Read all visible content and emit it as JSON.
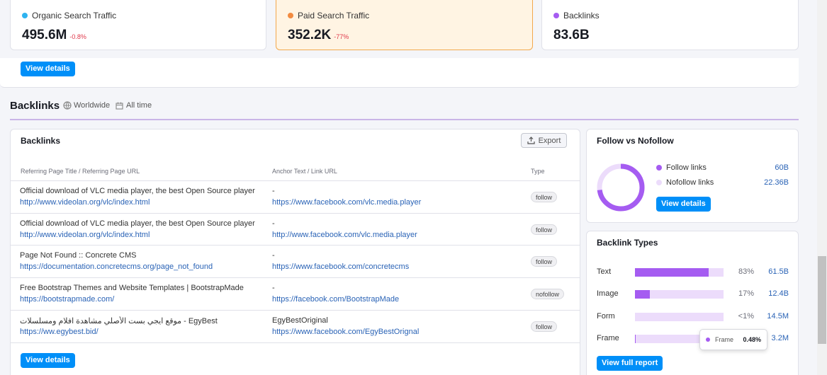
{
  "kpis": [
    {
      "label": "Organic Search Traffic",
      "value": "495.6M",
      "delta": "-0.8%",
      "color": "#2eb3f0"
    },
    {
      "label": "Paid Search Traffic",
      "value": "352.2K",
      "delta": "-77%",
      "color": "#f28b40"
    },
    {
      "label": "Backlinks",
      "value": "83.6B",
      "delta": "",
      "color": "#a55cf1"
    }
  ],
  "overview": {
    "view_details": "View details"
  },
  "section": {
    "title": "Backlinks",
    "region": "Worldwide",
    "period": "All time"
  },
  "backlinks_table": {
    "title": "Backlinks",
    "export_label": "Export",
    "columns": [
      "Referring Page Title / Referring Page URL",
      "Anchor Text / Link URL",
      "Type"
    ],
    "rows": [
      {
        "title": "Official download of VLC media player, the best Open Source player",
        "url": "http://www.videolan.org/vlc/index.html",
        "anchor": "-",
        "link": "https://www.facebook.com/vlc.media.player",
        "type": "follow"
      },
      {
        "title": "Official download of VLC media player, the best Open Source player",
        "url": "http://www.videolan.org/vlc/index.html",
        "anchor": "-",
        "link": "http://www.facebook.com/vlc.media.player",
        "type": "follow"
      },
      {
        "title": "Page Not Found :: Concrete CMS",
        "url": "https://documentation.concretecms.org/page_not_found",
        "anchor": "-",
        "link": "https://www.facebook.com/concretecms",
        "type": "follow"
      },
      {
        "title": "Free Bootstrap Themes and Website Templates | BootstrapMade",
        "url": "https://bootstrapmade.com/",
        "anchor": "-",
        "link": "https://facebook.com/BootstrapMade",
        "type": "nofollow"
      },
      {
        "title": "موقع ايجي بست الأصلي مشاهدة افلام ومسلسلات - EgyBest",
        "url": "https://ww.egybest.bid/",
        "anchor": "EgyBestOriginal",
        "link": "https://www.facebook.com/EgyBestOrignal",
        "type": "follow"
      }
    ],
    "view_details": "View details"
  },
  "follow": {
    "title": "Follow vs Nofollow",
    "items": [
      {
        "label": "Follow links",
        "value": "60B",
        "color": "#a55cf1"
      },
      {
        "label": "Nofollow links",
        "value": "22.36B",
        "color": "#ecdcfb"
      }
    ],
    "follow_fraction": 0.73,
    "view_details": "View details"
  },
  "types": {
    "title": "Backlink Types",
    "items": [
      {
        "label": "Text",
        "pct": "83%",
        "value": "61.5B",
        "fraction": 0.83
      },
      {
        "label": "Image",
        "pct": "17%",
        "value": "12.4B",
        "fraction": 0.17
      },
      {
        "label": "Form",
        "pct": "<1%",
        "value": "14.5M",
        "fraction": 0.0
      },
      {
        "label": "Frame",
        "pct": "",
        "value": "3.2M",
        "fraction": 0.0048
      }
    ],
    "tooltip": {
      "label": "Frame",
      "value": "0.48%"
    },
    "full_report": "View full report"
  }
}
